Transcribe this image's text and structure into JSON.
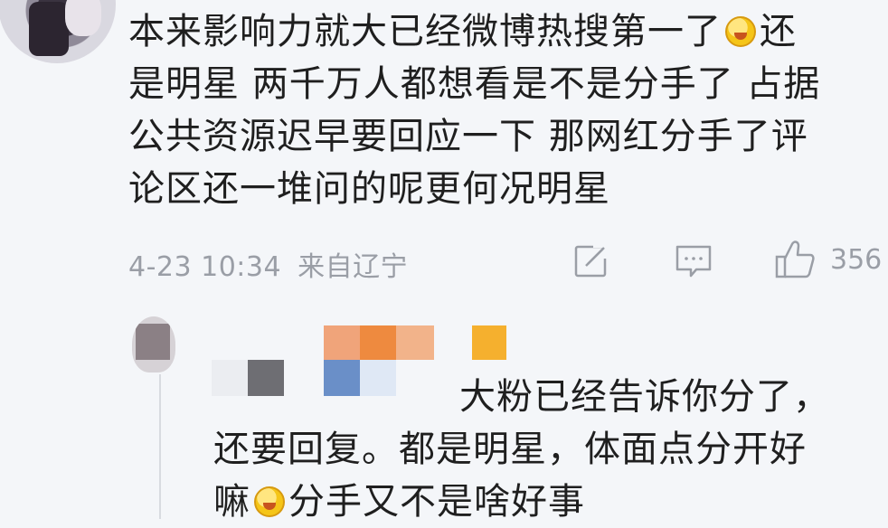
{
  "comment": {
    "text_part1": "本来影响力就大已经微博热搜第一了",
    "emoji_1": "laugh-cry-emoji",
    "text_part2": "还\n是明星 两千万人都想看是不是分手了 占据\n公共资源迟早要回应一下 那网红分手了评\n论区还一堆问的呢更何况明星",
    "timestamp": "4-23 10:34",
    "location": "来自辽宁",
    "like_count": "356"
  },
  "reply": {
    "line1": "大粉已经告诉你分了，",
    "line2": "还要回复。都是明星，体面点分开好",
    "line3_part1": "嘛",
    "emoji_2": "laugh-cry-emoji",
    "line3_part2": "分手又不是啥好事"
  },
  "colors": {
    "background": "#f4f6f9",
    "meta_text": "#9a9ea6",
    "body_text": "#1f1f1f"
  },
  "icons": [
    "share-icon",
    "comment-icon",
    "thumbs-up-icon",
    "laugh-cry-emoji"
  ]
}
